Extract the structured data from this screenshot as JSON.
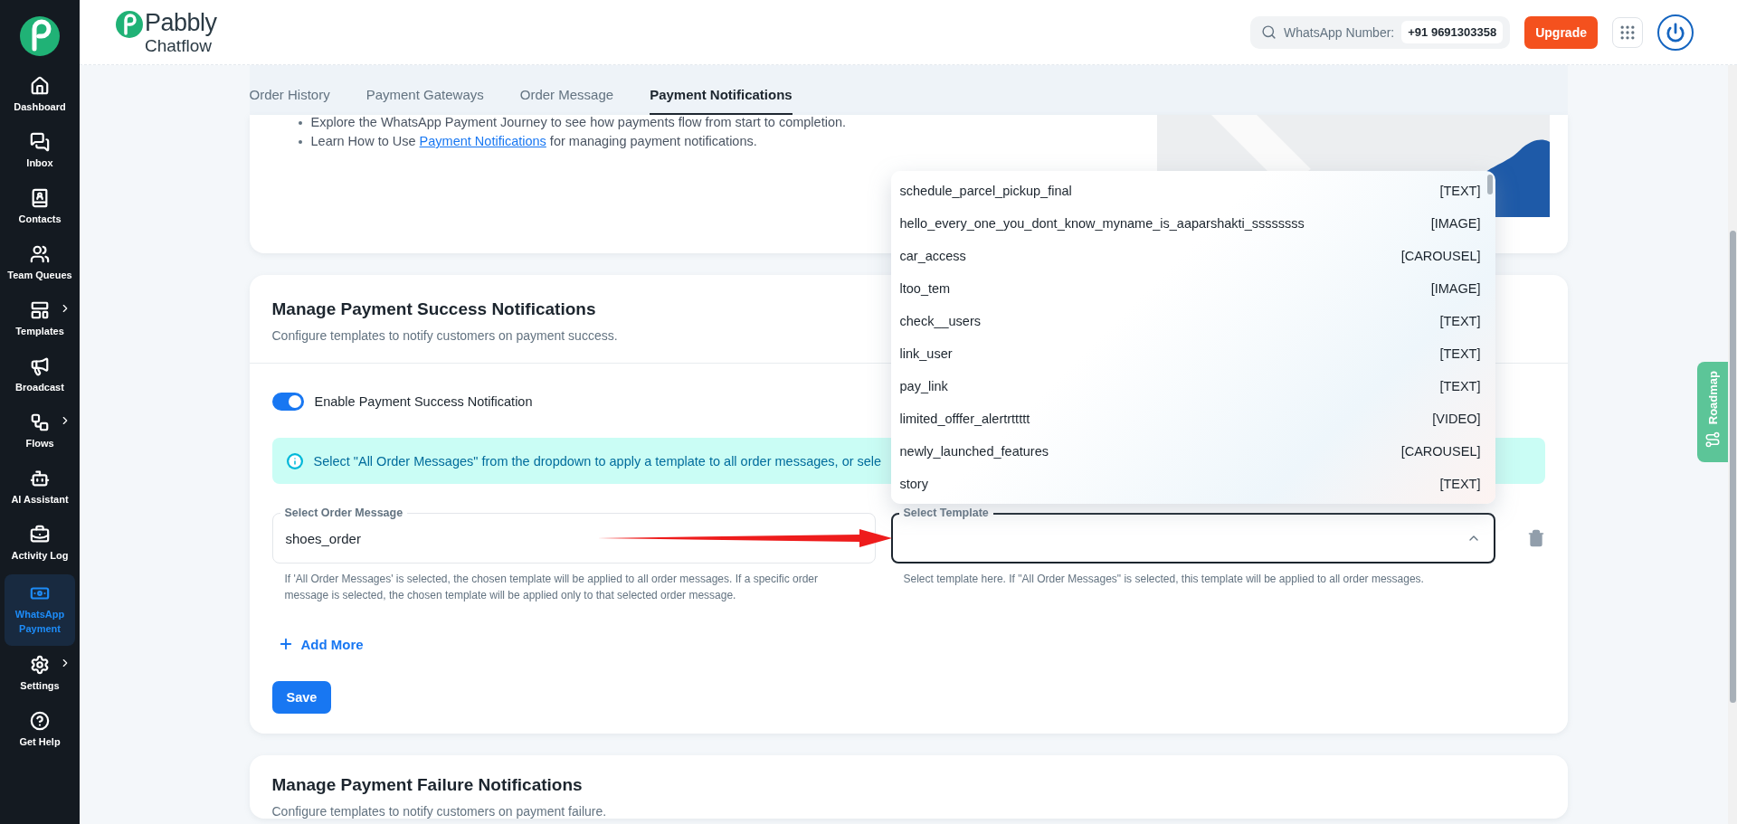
{
  "sidebar": {
    "items": [
      {
        "label": "Dashboard",
        "selected": false,
        "has_submenu": false
      },
      {
        "label": "Inbox",
        "selected": false,
        "has_submenu": false
      },
      {
        "label": "Contacts",
        "selected": false,
        "has_submenu": false
      },
      {
        "label": "Team Queues",
        "selected": false,
        "has_submenu": false
      },
      {
        "label": "Templates",
        "selected": false,
        "has_submenu": true
      },
      {
        "label": "Broadcast",
        "selected": false,
        "has_submenu": false
      },
      {
        "label": "Flows",
        "selected": false,
        "has_submenu": true
      },
      {
        "label": "AI Assistant",
        "selected": false,
        "has_submenu": false
      },
      {
        "label": "Activity Log",
        "selected": false,
        "has_submenu": false
      },
      {
        "label": "WhatsApp Payment",
        "selected": true,
        "has_submenu": false
      },
      {
        "label": "Settings",
        "selected": false,
        "has_submenu": true
      },
      {
        "label": "Get Help",
        "selected": false,
        "has_submenu": false
      }
    ]
  },
  "header": {
    "logo": {
      "name": "Pabbly",
      "product": "Chatflow"
    },
    "whatsapp_label": "WhatsApp Number:",
    "whatsapp_number": "+91 9691303358",
    "upgrade_button": "Upgrade"
  },
  "tabs": [
    {
      "label": "Order History",
      "selected": false
    },
    {
      "label": "Payment Gateways",
      "selected": false
    },
    {
      "label": "Order Message",
      "selected": false
    },
    {
      "label": "Payment Notifications",
      "selected": true
    }
  ],
  "intro": {
    "bullets": [
      {
        "text": "Explore the WhatsApp Payment Journey to see how payments flow from start to completion."
      },
      {
        "text": "Learn How to Use ",
        "link": "Payment Notifications",
        "text_after": " for managing payment notifications."
      }
    ]
  },
  "success_section": {
    "title": "Manage Payment Success Notifications",
    "subtitle": "Configure templates to notify customers on payment success.",
    "toggle": {
      "label": "Enable Payment Success Notification",
      "on": true
    },
    "info": "Select \"All Order Messages\" from the dropdown to apply a template to all order messages, or sele",
    "rows": [
      {
        "order_label": "Select Order Message",
        "order_value": "shoes_order",
        "order_help": "If 'All Order Messages' is selected, the chosen template will be applied to all order messages. If a specific order message is selected, the chosen template will be applied only to that selected order message.",
        "template_label": "Select Template",
        "template_help": "Select template here. If \"All Order Messages\" is selected, this template will be applied to all order messages.",
        "expanded": true,
        "options": [
          {
            "name": "schedule_parcel_pickup_final",
            "type": "[TEXT]"
          },
          {
            "name": "hello_every_one_you_dont_know_myname_is_aaparshakti_ssssssss",
            "type": "[IMAGE]"
          },
          {
            "name": "car_access",
            "type": "[CAROUSEL]"
          },
          {
            "name": "ltoo_tem",
            "type": "[IMAGE]"
          },
          {
            "name": "check__users",
            "type": "[TEXT]"
          },
          {
            "name": "link_user",
            "type": "[TEXT]"
          },
          {
            "name": "pay_link",
            "type": "[TEXT]"
          },
          {
            "name": "limited_offfer_alertrttttt",
            "type": "[VIDEO]"
          },
          {
            "name": "newly_launched_features",
            "type": "[CAROUSEL]"
          },
          {
            "name": "story",
            "type": "[TEXT]"
          }
        ]
      }
    ],
    "add_more": "Add More",
    "save_button": "Save"
  },
  "failure_section": {
    "title": "Manage Payment Failure Notifications",
    "subtitle": "Configure templates to notify customers on payment failure."
  },
  "roadmap": "Roadmap"
}
